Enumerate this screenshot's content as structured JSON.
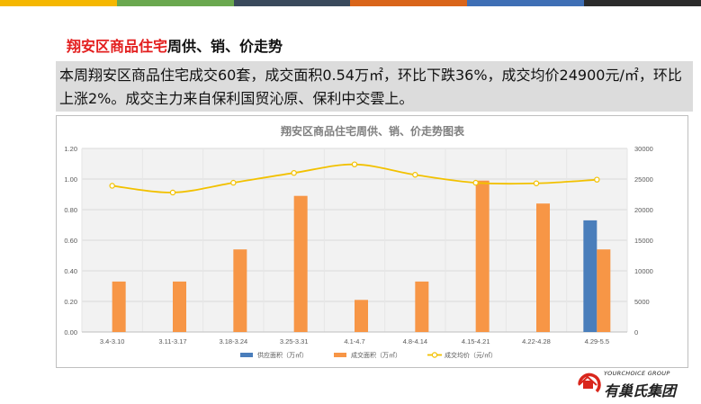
{
  "brand_colors": [
    "#f5b700",
    "#6aa84f",
    "#3a4a5c",
    "#d9651a",
    "#3f6fb5",
    "#2b2b2b"
  ],
  "heading": {
    "highlight": "翔安区商品住宅",
    "rest": "周供、销、价走势"
  },
  "summary": "本周翔安区商品住宅成交60套，成交面积0.54万㎡，环比下跌36%，成交均价24900元/㎡，环比上涨2%。成交主力来自保利国贸沁原、保利中交雲上。",
  "chart_data": {
    "type": "bar",
    "title": "翔安区商品住宅周供、销、价走势图表",
    "categories": [
      "3.4-3.10",
      "3.11-3.17",
      "3.18-3.24",
      "3.25-3.31",
      "4.1-4.7",
      "4.8-4.14",
      "4.15-4.21",
      "4.22-4.28",
      "4.29-5.5"
    ],
    "series": [
      {
        "name": "供应面积（万㎡）",
        "kind": "bar",
        "axis": "left",
        "color": "#4a7ebb",
        "values": [
          0,
          0,
          0,
          0,
          0,
          0,
          0,
          0,
          0.73
        ]
      },
      {
        "name": "成交面积（万㎡）",
        "kind": "bar",
        "axis": "left",
        "color": "#f79646",
        "values": [
          0.33,
          0.33,
          0.54,
          0.89,
          0.21,
          0.33,
          0.99,
          0.84,
          0.54
        ]
      },
      {
        "name": "成交均价（元/㎡）",
        "kind": "line",
        "axis": "right",
        "color": "#f2c100",
        "values": [
          23900,
          22800,
          24400,
          26000,
          27400,
          25700,
          24400,
          24300,
          24900
        ]
      }
    ],
    "y_left": {
      "ticks": [
        "0.00",
        "0.20",
        "0.40",
        "0.60",
        "0.80",
        "1.00",
        "1.20"
      ],
      "range": [
        0,
        1.2
      ]
    },
    "y_right": {
      "ticks": [
        "0",
        "5000",
        "10000",
        "15000",
        "20000",
        "25000",
        "30000"
      ],
      "range": [
        0,
        30000
      ]
    },
    "legend_position": "bottom",
    "grid": true
  },
  "logo": {
    "en": "YOURCHOICE GROUP",
    "cn": "有巢氏集团"
  }
}
